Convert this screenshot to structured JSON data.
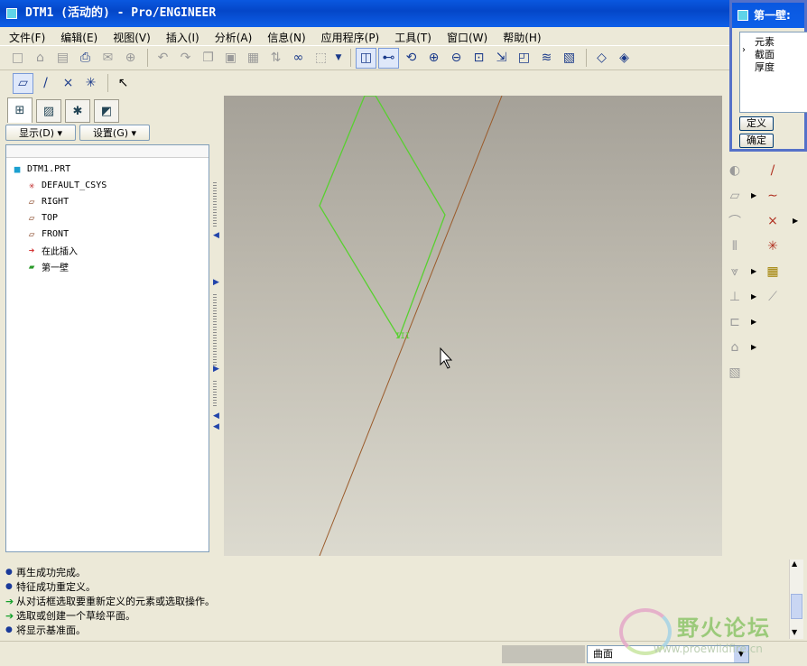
{
  "window": {
    "title": "DTM1 (活动的) - Pro/ENGINEER"
  },
  "menu": [
    "文件(F)",
    "编辑(E)",
    "视图(V)",
    "插入(I)",
    "分析(A)",
    "信息(N)",
    "应用程序(P)",
    "工具(T)",
    "窗口(W)",
    "帮助(H)"
  ],
  "model_tree": {
    "show_button": "显示(D) ▾",
    "settings_button": "设置(G) ▾",
    "items": [
      {
        "label": "DTM1.PRT",
        "icon": "part-icon"
      },
      {
        "label": "DEFAULT_CSYS",
        "icon": "csys-icon"
      },
      {
        "label": "RIGHT",
        "icon": "datum-plane-icon"
      },
      {
        "label": "TOP",
        "icon": "datum-plane-icon"
      },
      {
        "label": "FRONT",
        "icon": "datum-plane-icon"
      },
      {
        "label": "在此插入",
        "icon": "insert-arrow-icon"
      },
      {
        "label": "第一壁",
        "icon": "wall-feature-icon"
      }
    ]
  },
  "dialog": {
    "title": "第一壁:",
    "list_header": "元素",
    "elements": [
      "截面",
      "厚度"
    ],
    "define_button": "定义",
    "ok_button": "确定"
  },
  "messages": [
    {
      "type": "bullet",
      "text": "再生成功完成。"
    },
    {
      "type": "bullet",
      "text": "特征成功重定义。"
    },
    {
      "type": "arrow",
      "text": "从对话框选取要重新定义的元素或选取操作。"
    },
    {
      "type": "arrow",
      "text": "选取或创建一个草绘平面。"
    },
    {
      "type": "bullet",
      "text": "将显示基准面。"
    }
  ],
  "status": {
    "filter_value": "曲面"
  },
  "watermark": {
    "text": "野火论坛",
    "url": "www.proewildfire.cn"
  },
  "colors": {
    "title_blue": "#0a58e0",
    "sketch_green": "#58d030",
    "datum_brown": "#9a5a2a"
  }
}
